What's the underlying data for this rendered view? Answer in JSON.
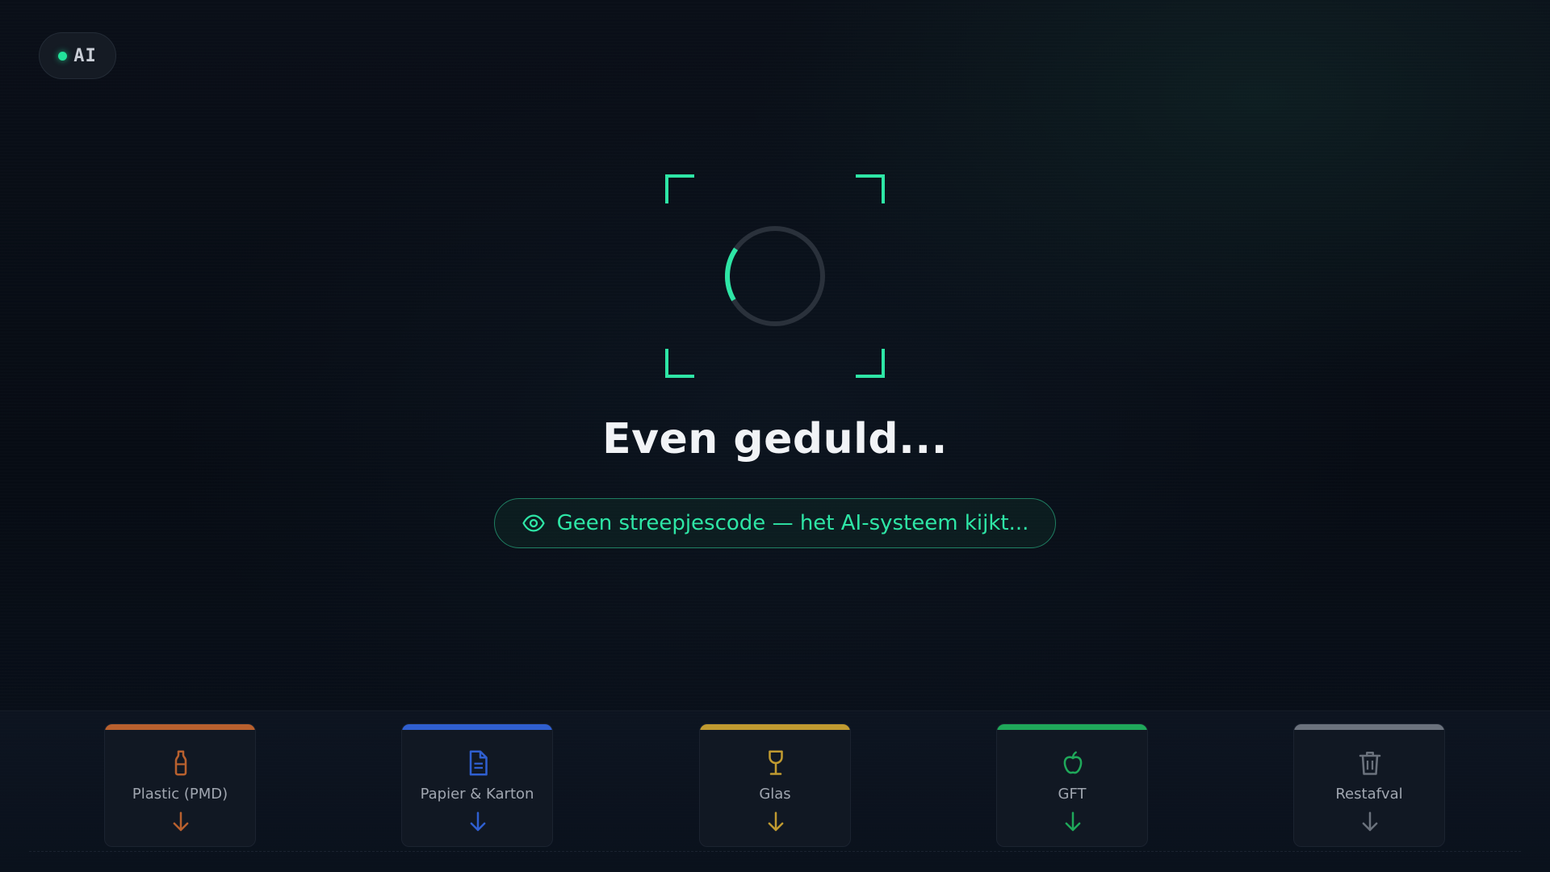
{
  "badge": {
    "label": "AI",
    "status_color": "#22e39a"
  },
  "scanner": {
    "accent_color": "#2ee6a6",
    "progress_fraction": 0.18
  },
  "title": "Even geduld...",
  "status": {
    "icon": "eye-icon",
    "text": "Geen streepjescode — het AI-systeem kijkt..."
  },
  "bins": [
    {
      "label": "Plastic (PMD)",
      "icon": "bottle-icon",
      "color": "#b8602e"
    },
    {
      "label": "Papier & Karton",
      "icon": "document-icon",
      "color": "#2f5fd0"
    },
    {
      "label": "Glas",
      "icon": "wine-glass-icon",
      "color": "#c09a30"
    },
    {
      "label": "GFT",
      "icon": "apple-icon",
      "color": "#1fa85a"
    },
    {
      "label": "Restafval",
      "icon": "trash-icon",
      "color": "#6b727d"
    }
  ]
}
